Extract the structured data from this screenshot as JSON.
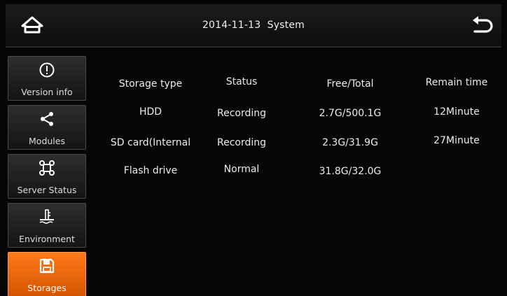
{
  "header": {
    "title": "2014-11-13  System",
    "home_icon": "home-icon",
    "back_icon": "back-arrow-icon"
  },
  "sidebar": {
    "items": [
      {
        "label": "Version info",
        "icon": "info-icon",
        "active": false
      },
      {
        "label": "Modules",
        "icon": "share-icon",
        "active": false
      },
      {
        "label": "Server Status",
        "icon": "network-icon",
        "active": false
      },
      {
        "label": "Environment",
        "icon": "thermometer-icon",
        "active": false
      },
      {
        "label": "Storages",
        "icon": "floppy-disk-icon",
        "active": true
      }
    ]
  },
  "storage_table": {
    "headers": [
      "Storage type",
      "Status",
      "Free/Total",
      "Remain time"
    ],
    "rows": [
      [
        "HDD",
        "Recording",
        "2.7G/500.1G",
        "12Minute"
      ],
      [
        "SD card(Internal",
        "Recording",
        "2.3G/31.9G",
        "27Minute"
      ],
      [
        "Flash drive",
        "Normal",
        "31.8G/32.0G",
        ""
      ]
    ]
  },
  "colors": {
    "accent": "#e8650a",
    "background": "#060606",
    "button": "#232323"
  }
}
